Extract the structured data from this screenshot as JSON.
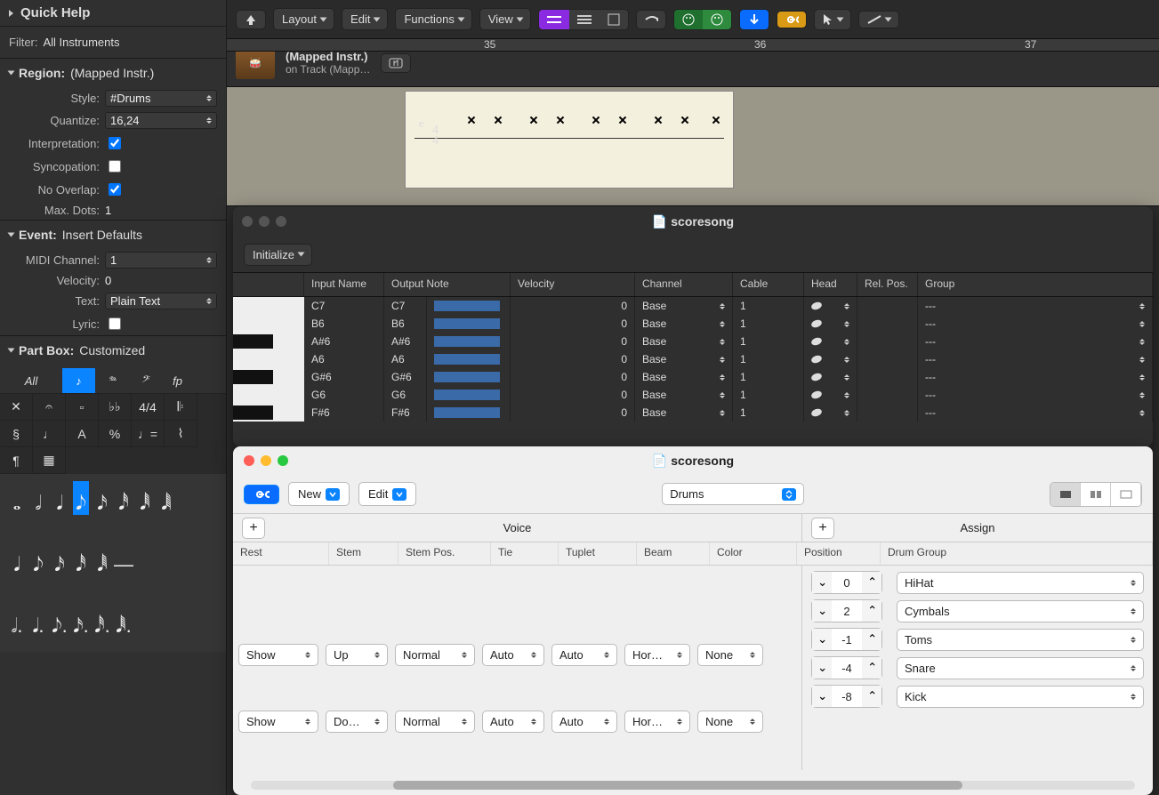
{
  "sidebar": {
    "quick_help": "Quick Help",
    "filter_label": "Filter:",
    "filter_value": "All Instruments",
    "region_hdr": "Region:",
    "region_value": "(Mapped Instr.)",
    "style_label": "Style:",
    "style_value": "#Drums",
    "quantize_label": "Quantize:",
    "quantize_value": "16,24",
    "interp_label": "Interpretation:",
    "sync_label": "Syncopation:",
    "noover_label": "No Overlap:",
    "maxdots_label": "Max. Dots:",
    "maxdots_value": "1",
    "event_hdr": "Event:",
    "event_value": "Insert Defaults",
    "midich_label": "MIDI Channel:",
    "midich_value": "1",
    "vel_label": "Velocity:",
    "vel_value": "0",
    "text_label": "Text:",
    "text_value": "Plain Text",
    "lyric_label": "Lyric:",
    "partbox_hdr": "Part Box:",
    "partbox_value": "Customized",
    "partbox_all": "All"
  },
  "toolbar": {
    "layout": "Layout",
    "edit": "Edit",
    "functions": "Functions",
    "view": "View"
  },
  "track": {
    "name": "(Mapped Instr.)",
    "subtitle": "on Track (Mapp…"
  },
  "ruler": {
    "m1": "35",
    "m2": "36",
    "m3": "37"
  },
  "dm": {
    "title": "scoresong",
    "initialize": "Initialize",
    "headers": {
      "input": "Input Name",
      "output": "Output Note",
      "velocity": "Velocity",
      "channel": "Channel",
      "cable": "Cable",
      "head": "Head",
      "relpos": "Rel. Pos.",
      "group": "Group"
    },
    "rows": [
      {
        "in": "C7",
        "out": "C7",
        "vel": "0",
        "ch": "Base",
        "cable": "1",
        "group": "---"
      },
      {
        "in": "B6",
        "out": "B6",
        "vel": "0",
        "ch": "Base",
        "cable": "1",
        "group": "---"
      },
      {
        "in": "A#6",
        "out": "A#6",
        "vel": "0",
        "ch": "Base",
        "cable": "1",
        "group": "---"
      },
      {
        "in": "A6",
        "out": "A6",
        "vel": "0",
        "ch": "Base",
        "cable": "1",
        "group": "---"
      },
      {
        "in": "G#6",
        "out": "G#6",
        "vel": "0",
        "ch": "Base",
        "cable": "1",
        "group": "---"
      },
      {
        "in": "G6",
        "out": "G6",
        "vel": "0",
        "ch": "Base",
        "cable": "1",
        "group": "---"
      },
      {
        "in": "F#6",
        "out": "F#6",
        "vel": "0",
        "ch": "Base",
        "cable": "1",
        "group": "---"
      }
    ]
  },
  "ss": {
    "title": "scoresong",
    "new": "New",
    "edit": "Edit",
    "style": "Drums",
    "voice_h": "Voice",
    "assign_h": "Assign",
    "cols": {
      "rest": "Rest",
      "stem": "Stem",
      "stempos": "Stem Pos.",
      "tie": "Tie",
      "tuplet": "Tuplet",
      "beam": "Beam",
      "color": "Color",
      "pos": "Position",
      "drum": "Drum Group"
    },
    "voice1": {
      "rest": "Show",
      "stem": "Up",
      "stempos": "Normal",
      "tie": "Auto",
      "tuplet": "Auto",
      "beam": "Hor…",
      "color": "None"
    },
    "voice2": {
      "rest": "Show",
      "stem": "Do…",
      "stempos": "Normal",
      "tie": "Auto",
      "tuplet": "Auto",
      "beam": "Hor…",
      "color": "None"
    },
    "assigns": [
      {
        "pos": "0",
        "grp": "HiHat"
      },
      {
        "pos": "2",
        "grp": "Cymbals"
      },
      {
        "pos": "-1",
        "grp": "Toms"
      },
      {
        "pos": "-4",
        "grp": "Snare"
      },
      {
        "pos": "-8",
        "grp": "Kick"
      }
    ]
  }
}
